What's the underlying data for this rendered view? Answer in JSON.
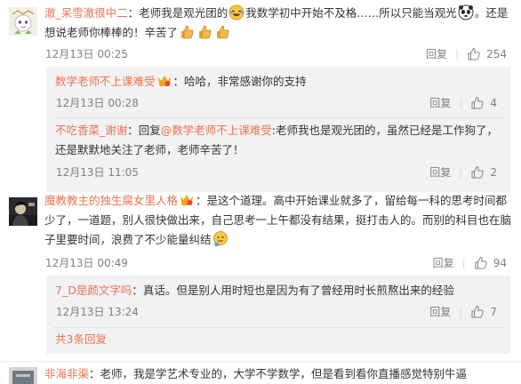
{
  "actions": {
    "reply": "回复"
  },
  "comments": [
    {
      "user": "澈_呆雪澈很中二",
      "sep": "：",
      "text1": "老师我是观光团的",
      "text2": "我数学初中开始不及格……所以只能当观光",
      "text3": "。还是想说老师你棒棒的！辛苦了",
      "time": "12月13日 00:25",
      "likes": "254",
      "replies": [
        {
          "user": "数学老师不上课难受",
          "text": "：哈哈，非常感谢你的支持",
          "time": "12月13日 00:28",
          "likes": "4"
        },
        {
          "user": "不吃香菜_谢谢",
          "text_a": "：回复",
          "mention": "@数学老师不上课难受",
          "text_b": ":老师我也是观光团的，虽然已经是工作狗了，还是默默地关注了老师，老师辛苦了！",
          "time": "12月13日 11:05",
          "likes": "2"
        }
      ]
    },
    {
      "user": "魔教教主的独生腐女里人格",
      "text": "：是这个道理。高中开始课业就多了，留给每一科的思考时间都少了，一道题，别人很快做出来，自己思考一上午都没有结果，挺打击人的。而别的科目也在脑子里要时间，浪费了不少能量纠结",
      "time": "12月13日 00:49",
      "likes": "94",
      "replies": [
        {
          "user": "7_D是颜文字吗",
          "text": "：真话。但是别人用时短也是因为有了曾经用时长煎熬出来的经验",
          "time": "12月13日 13:24",
          "likes": "7"
        }
      ],
      "more": "共3条回复"
    },
    {
      "user": "非海非渠",
      "text": "：老师，我是学艺术专业的，大学不学数学，但是看到看你直播感觉特别牛逼"
    }
  ]
}
